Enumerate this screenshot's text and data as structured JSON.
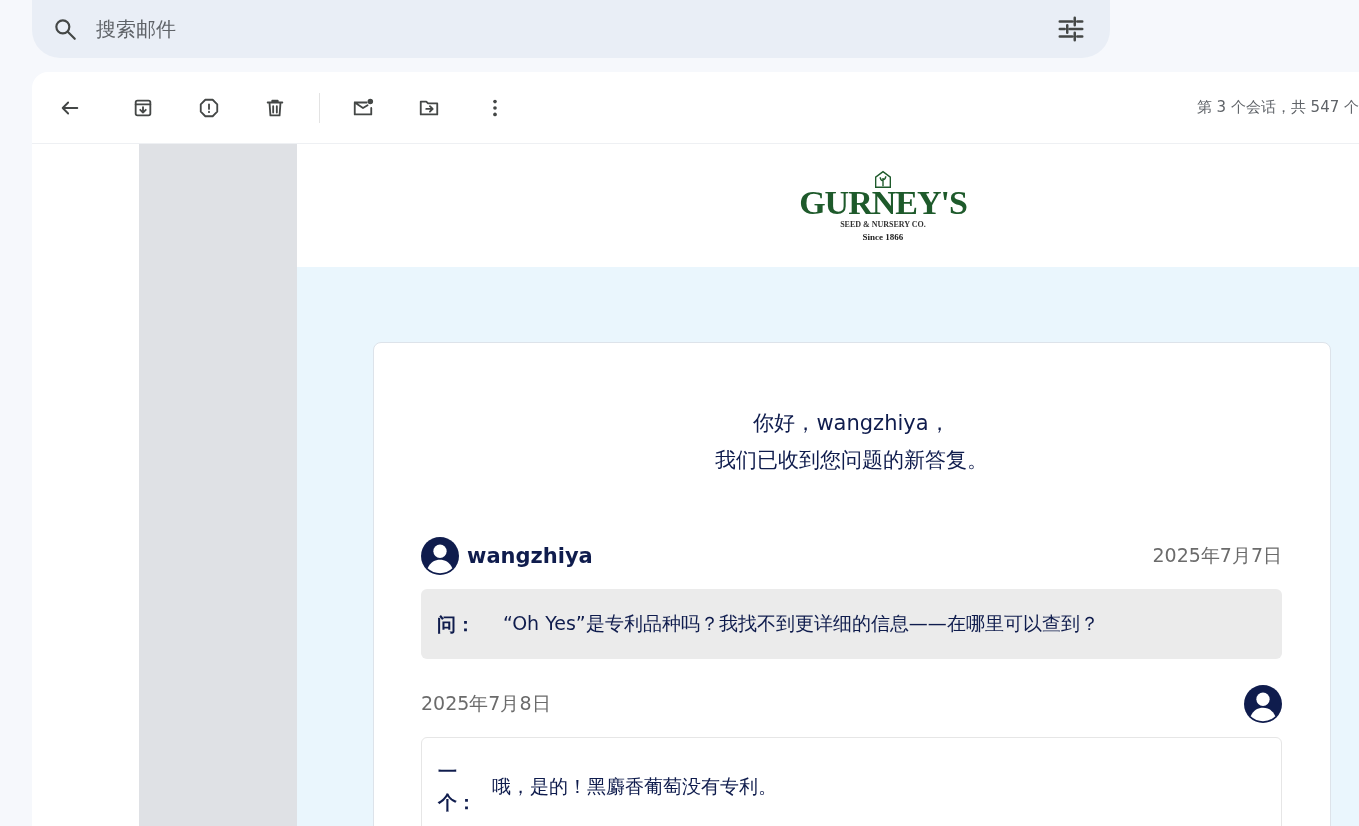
{
  "search": {
    "placeholder": "搜索邮件"
  },
  "toolbar": {
    "counter": "第 3 个会话，共 547 个"
  },
  "logo": {
    "name": "GURNEY'S",
    "tagline": "SEED & NURSERY CO.",
    "since": "Since 1866"
  },
  "greeting": [
    "你好，wangzhiya，",
    "我们已收到您问题的新答复。"
  ],
  "messages": [
    {
      "kind": "question",
      "author": "wangzhiya",
      "date": "2025年7月7日",
      "label": "问：",
      "text": "“Oh Yes”是专利品种吗？我找不到更详细的信息——在哪里可以查到？"
    },
    {
      "kind": "answer",
      "date": "2025年7月8日",
      "label": "一个：",
      "text": "哦，是的！黑麝香葡萄没有专利。"
    }
  ]
}
